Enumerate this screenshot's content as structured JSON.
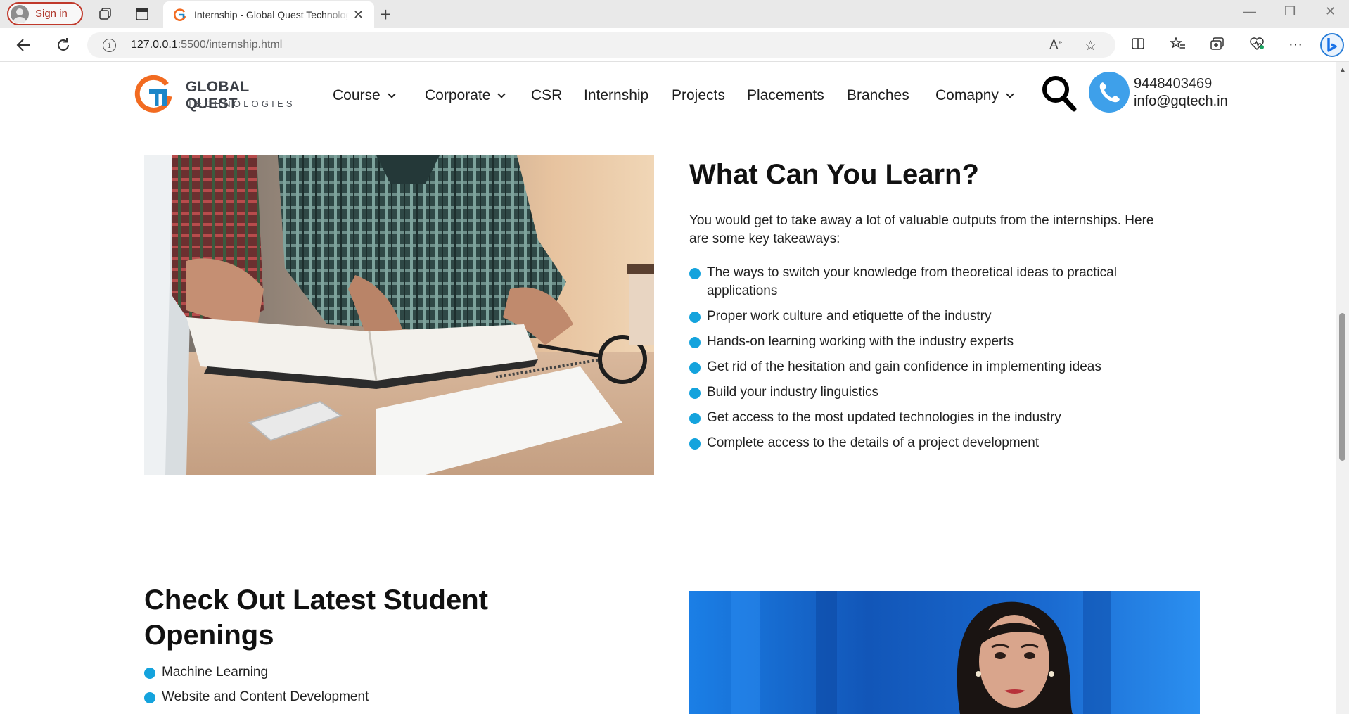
{
  "browser": {
    "signin_label": "Sign in",
    "tab_title": "Internship - Global Quest Technologies",
    "url_host": "127.0.0.1",
    "url_path": ":5500/internship.html"
  },
  "header": {
    "logo_line1": "GLOBAL QUEST",
    "logo_line2": "TECHNOLOGIES",
    "nav": [
      {
        "label": "Course",
        "dropdown": true
      },
      {
        "label": "Corporate",
        "dropdown": true
      },
      {
        "label": "CSR",
        "dropdown": false
      },
      {
        "label": "Internship",
        "dropdown": false
      },
      {
        "label": "Projects",
        "dropdown": false
      },
      {
        "label": "Placements",
        "dropdown": false
      },
      {
        "label": "Branches",
        "dropdown": false
      },
      {
        "label": "Comapny",
        "dropdown": true
      }
    ],
    "phone": "9448403469",
    "email": "info@gqtech.in"
  },
  "learn": {
    "title": "What Can You Learn?",
    "intro": "You would get to take away a lot of valuable outputs from the internships. Here are some key takeaways:",
    "items": [
      "The ways to switch your knowledge from theoretical ideas to practical applications",
      "Proper work culture and etiquette of the industry",
      "Hands-on learning working with the industry experts",
      "Get rid of the hesitation and gain confidence in implementing ideas",
      "Build your industry linguistics",
      "Get access to the most updated technologies in the industry",
      "Complete access to the details of a project development"
    ]
  },
  "openings": {
    "title": "Check Out Latest Student Openings",
    "items": [
      "Machine Learning",
      "Website and Content Development"
    ]
  },
  "colors": {
    "accent": "#14a3dd",
    "phone_circle": "#3ea0ea",
    "logo_orange": "#f26b21",
    "logo_blue": "#1b86c8",
    "signin_border": "#c0392b"
  },
  "icons": [
    "back-icon",
    "refresh-icon",
    "info-icon",
    "read-aloud-icon",
    "favorite-icon",
    "split-screen-icon",
    "favorites-icon",
    "collections-icon",
    "browser-essentials-icon",
    "more-icon",
    "bing-icon",
    "search-icon",
    "phone-icon"
  ]
}
